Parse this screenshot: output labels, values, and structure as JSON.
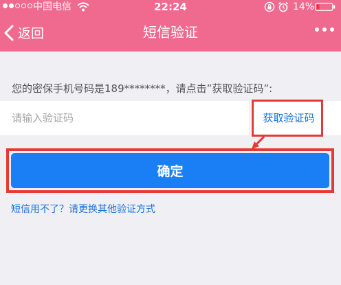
{
  "status_bar": {
    "carrier": "中国电信",
    "time": "22:24",
    "battery_percent": "14%",
    "icons": [
      "signal-dots",
      "wifi-icon",
      "rotation-lock-icon",
      "alarm-icon",
      "battery-icon"
    ]
  },
  "nav": {
    "back_label": "返回",
    "title": "短信验证",
    "more_icon": "more-dots-icon"
  },
  "hint": "您的密保手机号码是189********，请点击”获取验证码”:",
  "code_input": {
    "placeholder": "请输入验证码",
    "value": ""
  },
  "get_code_label": "获取验证码",
  "confirm_label": "确定",
  "alt_link_label": "短信用不了？请更换其他验证方式",
  "colors": {
    "header": "#f0698f",
    "primary_button": "#1a7ff5",
    "link": "#1a73d9",
    "annotation_red": "#e53935",
    "background": "#efeff4"
  }
}
